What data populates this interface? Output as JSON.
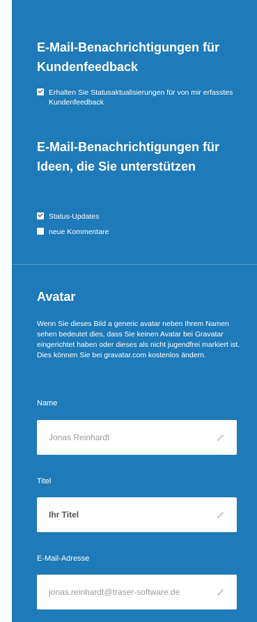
{
  "email_feedback": {
    "heading": "E-Mail-Benachrichtigungen für Kundenfeedback",
    "option_status": "Erhalten Sie Statusaktualisierungen für von mir erfasstes Kundenfeedback",
    "option_status_checked": true
  },
  "email_ideas": {
    "heading": "E-Mail-Benachrichtigungen für Ideen, die Sie unterstützen",
    "option_status_updates": "Status-Updates",
    "option_status_updates_checked": true,
    "option_new_comments": "neue Kommentare",
    "option_new_comments_checked": false
  },
  "avatar": {
    "heading": "Avatar",
    "description": "Wenn Sie dieses Bild a generic avatar neben Ihrem Namen sehen bedeutet dies, dass Sie keinen Avatar bei Gravatar eingerichtet haben oder dieses als nicht jugendfrei markiert ist. Dies können Sie bei gravatar.com kostenlos ändern."
  },
  "fields": {
    "name_label": "Name",
    "name_value": "Jonas Reinhardt",
    "title_label": "Titel",
    "title_value": "Ihr Titel",
    "email_label": "E-Mail-Adresse",
    "email_value": "jonas.reinhardt@traser-software.de"
  },
  "colors": {
    "panel_background": "#1e7ab8",
    "field_background": "#ffffff"
  },
  "icons": {
    "edit": "pencil-icon",
    "checkbox": "checkbox-icon"
  }
}
